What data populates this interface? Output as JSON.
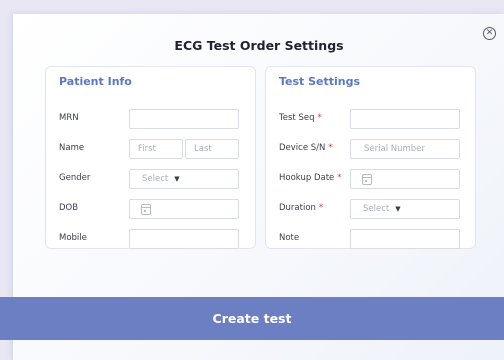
{
  "dialog": {
    "title": "ECG Test Order Settings",
    "close_glyph": "✕"
  },
  "patient_info": {
    "heading": "Patient Info",
    "mrn_label": "MRN",
    "mrn_value": "",
    "name_label": "Name",
    "first_placeholder": "First",
    "last_placeholder": "Last",
    "gender_label": "Gender",
    "gender_selected": "Select",
    "dob_label": "DOB",
    "mobile_label": "Mobile",
    "mobile_value": ""
  },
  "test_settings": {
    "heading": "Test Settings",
    "test_seq_label": "Test Seq",
    "test_seq_value": "",
    "device_sn_label": "Device S/N",
    "device_sn_placeholder": "Serial Number",
    "hookup_date_label": "Hookup Date",
    "duration_label": "Duration",
    "duration_selected": "Select",
    "note_label": "Note",
    "note_value": "",
    "required_mark": "*"
  },
  "actions": {
    "create_label": "Create test"
  },
  "icons": {
    "close": "close-circle-icon",
    "calendar": "calendar-icon",
    "chevron": "chevron-down-icon"
  },
  "colors": {
    "accent": "#5b79c0",
    "button": "#6c7fc2",
    "required": "#e0344a"
  }
}
